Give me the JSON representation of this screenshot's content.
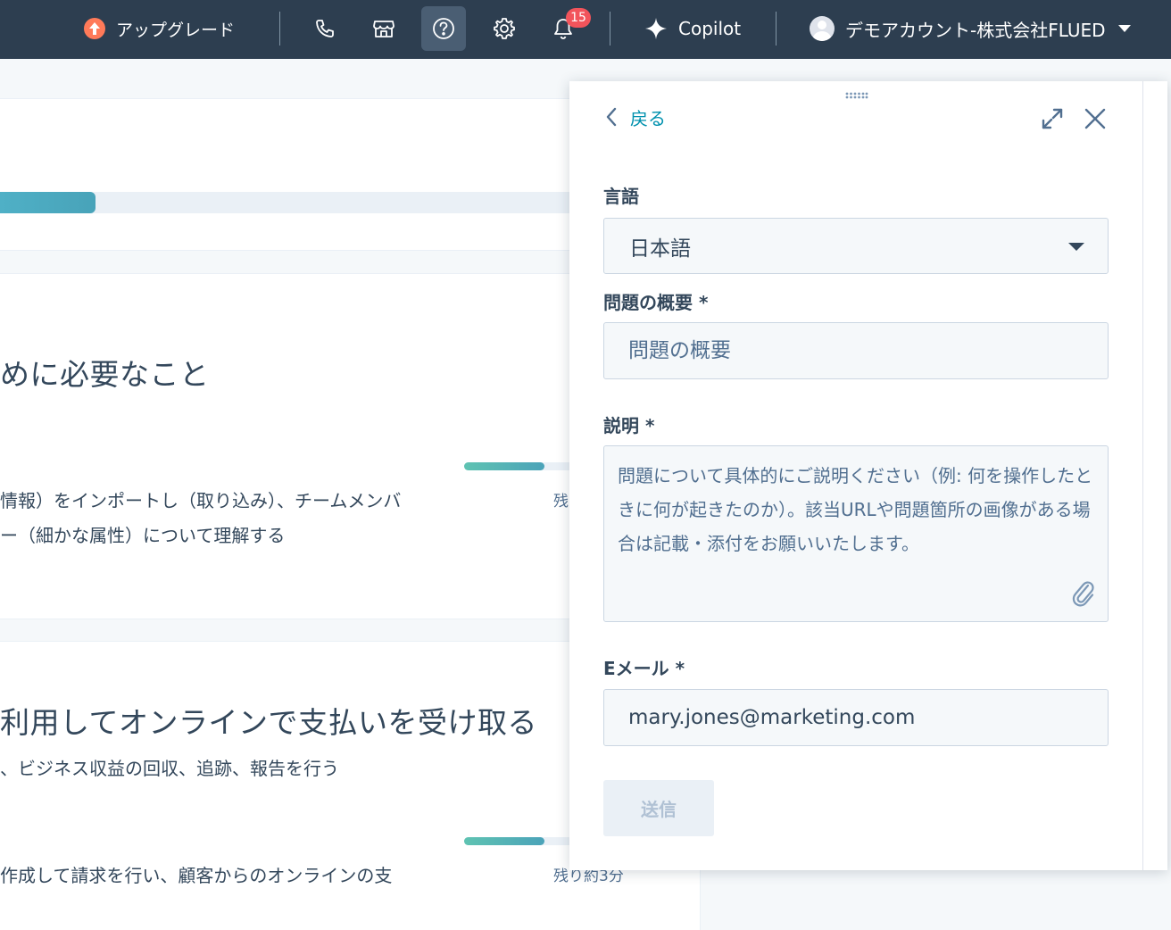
{
  "topbar": {
    "upgrade_label": "アップグレード",
    "notification_count": "15",
    "copilot_label": "Copilot",
    "account_name": "デモアカウント-株式会社FLUED"
  },
  "background": {
    "card2_heading": "めに必要なこと",
    "card2_line1": "情報）をインポートし（取り込み）、チームメンバ",
    "card2_line2": "ー（細かな属性）について理解する",
    "card2_remaining": "残",
    "card3_heading": "利用してオンラインで支払いを受け取る",
    "card3_subtitle": "、ビジネス収益の回収、追跡、報告を行う",
    "card3_line1": "作成して請求を行い、顧客からのオンラインの支",
    "card3_remaining": "残り約3分",
    "progress": {
      "main": 0.155,
      "task1": 0.45,
      "task2": 0.45
    }
  },
  "panel": {
    "back_label": "戻る",
    "language_label": "言語",
    "language_value": "日本語",
    "summary_label": "問題の概要 *",
    "summary_placeholder": "問題の概要",
    "description_label": "説明 *",
    "description_placeholder": "問題について具体的にご説明ください（例: 何を操作したときに何が起きたのか）。該当URLや問題箇所の画像がある場合は記載・添付をお願いいたします。",
    "email_label": "Eメール *",
    "email_value": "mary.jones@marketing.com",
    "submit_label": "送信"
  },
  "colors": {
    "topbar_bg": "#2d3e50",
    "link": "#0091ae",
    "upgrade_accent": "#ff7a59",
    "badge": "#f2545b"
  },
  "icons": [
    "upgrade-icon",
    "phone-icon",
    "marketplace-icon",
    "help-icon",
    "settings-icon",
    "bell-icon",
    "copilot-sparkle-icon",
    "avatar",
    "chevron-left-icon",
    "expand-icon",
    "close-icon",
    "paperclip-icon",
    "drag-handle-icon"
  ]
}
